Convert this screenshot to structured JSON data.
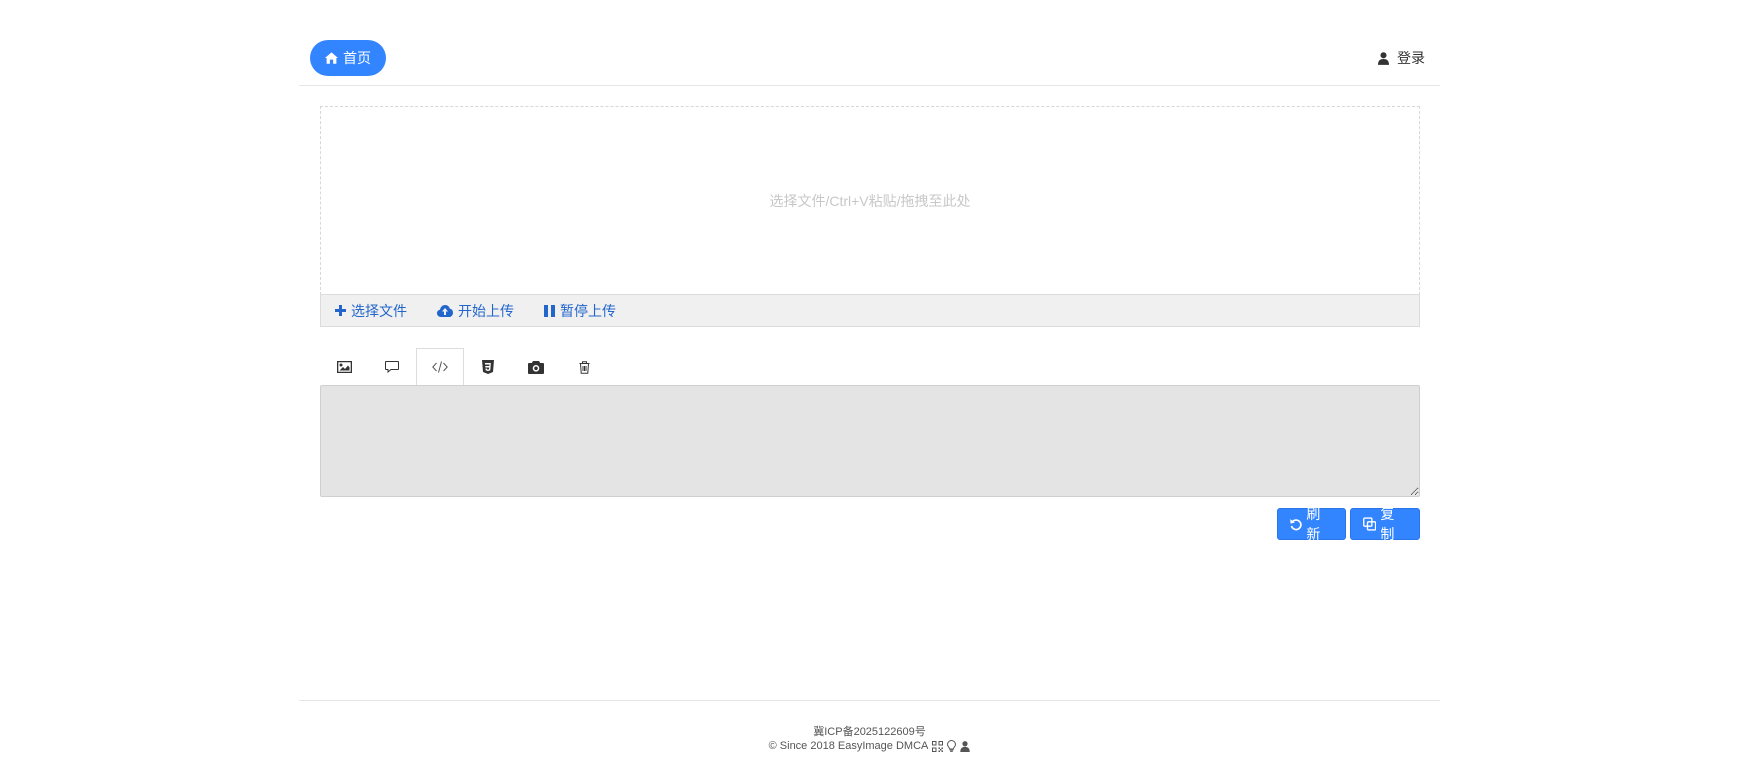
{
  "header": {
    "home_label": "首页",
    "login_label": "登录"
  },
  "upload": {
    "dropzone_hint": "选择文件/Ctrl+V粘贴/拖拽至此处",
    "select_files_label": "选择文件",
    "start_upload_label": "开始上传",
    "pause_upload_label": "暂停上传"
  },
  "tabs": [
    {
      "icon": "image-icon",
      "active": false
    },
    {
      "icon": "comment-icon",
      "active": false
    },
    {
      "icon": "code-icon",
      "active": true
    },
    {
      "icon": "html5-icon",
      "active": false
    },
    {
      "icon": "camera-icon",
      "active": false
    },
    {
      "icon": "trash-icon",
      "active": false
    }
  ],
  "result": {
    "textarea_value": ""
  },
  "actions": {
    "refresh_label": "刷新",
    "copy_label": "复制"
  },
  "footer": {
    "icp": "冀ICP备2025122609号",
    "copyright": "© Since 2018 EasyImage DMCA"
  },
  "colors": {
    "primary": "#3385ff",
    "link": "#2266cc",
    "textarea_bg": "#e4e4e4"
  }
}
